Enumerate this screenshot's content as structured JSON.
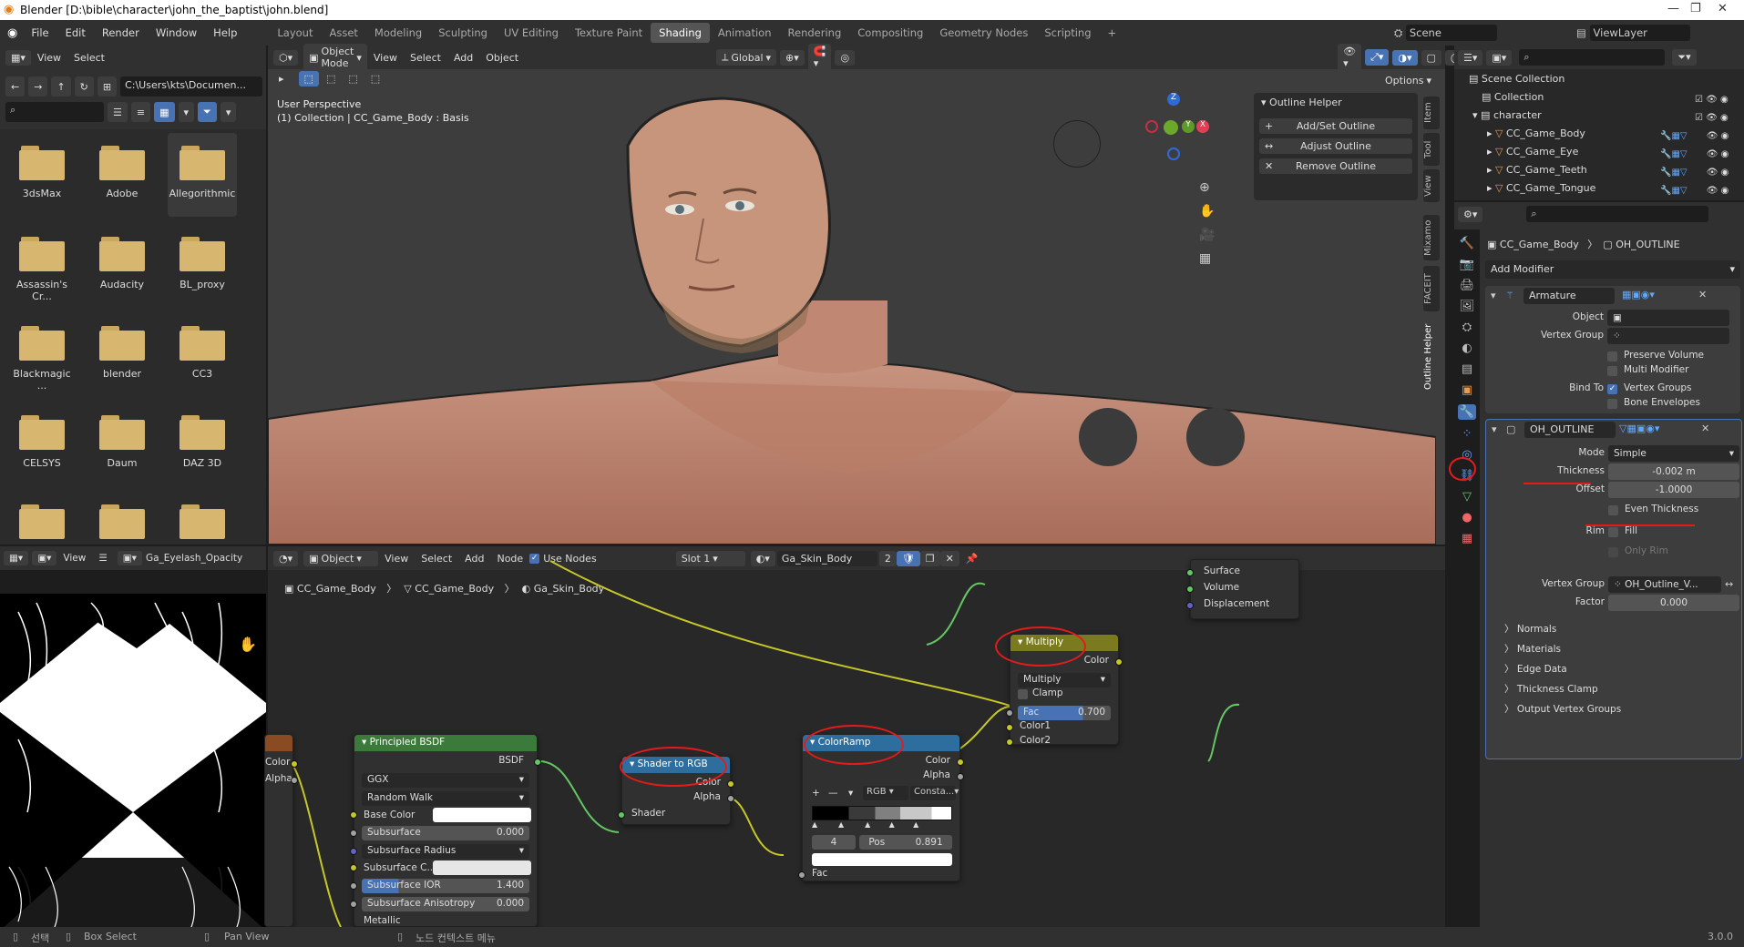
{
  "window": {
    "title": "Blender [D:\\bible\\character\\john_the_baptist\\john.blend]"
  },
  "menus": [
    "File",
    "Edit",
    "Render",
    "Window",
    "Help"
  ],
  "workspaces": [
    {
      "label": "Layout"
    },
    {
      "label": "Asset"
    },
    {
      "label": "Modeling"
    },
    {
      "label": "Sculpting"
    },
    {
      "label": "UV Editing"
    },
    {
      "label": "Texture Paint"
    },
    {
      "label": "Shading",
      "active": true
    },
    {
      "label": "Animation"
    },
    {
      "label": "Rendering"
    },
    {
      "label": "Compositing"
    },
    {
      "label": "Geometry Nodes"
    },
    {
      "label": "Scripting"
    }
  ],
  "scene": "Scene",
  "view_layer": "ViewLayer",
  "file_browser": {
    "view": "View",
    "select": "Select",
    "path": "C:\\Users\\kts\\Documen...",
    "folders": [
      "3dsMax",
      "Adobe",
      "Allegorithmic",
      "Assassin's Cr...",
      "Audacity",
      "BL_proxy",
      "Blackmagic ...",
      "blender",
      "CC3",
      "CELSYS",
      "Daum",
      "DAZ 3D"
    ]
  },
  "viewport": {
    "mode": "Object Mode",
    "view": "View",
    "select": "Select",
    "add": "Add",
    "object": "Object",
    "orientation": "Global",
    "options": "Options",
    "perspective": "User Perspective",
    "collection_info": "(1) Collection | CC_Game_Body : Basis",
    "gizmo": {
      "x": "X",
      "y": "Y",
      "z": "Z"
    }
  },
  "outline_helper": {
    "title": "Outline Helper",
    "buttons": [
      "Add/Set Outline",
      "Adjust Outline",
      "Remove Outline"
    ]
  },
  "side_tabs": [
    "Item",
    "Tool",
    "View",
    "Mixamo",
    "FACEIT",
    "Outline Helper"
  ],
  "outliner": {
    "scene_collection": "Scene Collection",
    "collection": "Collection",
    "character": "character",
    "items": [
      "CC_Game_Body",
      "CC_Game_Eye",
      "CC_Game_Teeth",
      "CC_Game_Tongue"
    ]
  },
  "properties": {
    "breadcrumb_obj": "CC_Game_Body",
    "breadcrumb_mod": "OH_OUTLINE",
    "add_modifier": "Add Modifier",
    "armature": {
      "name": "Armature",
      "object_label": "Object",
      "vgroup_label": "Vertex Group",
      "preserve_volume": "Preserve Volume",
      "multi_modifier": "Multi Modifier",
      "bind_to": "Bind To",
      "vertex_groups": "Vertex Groups",
      "bone_envelopes": "Bone Envelopes"
    },
    "outline": {
      "name": "OH_OUTLINE",
      "mode_label": "Mode",
      "mode": "Simple",
      "thickness_label": "Thickness",
      "thickness": "-0.002 m",
      "offset_label": "Offset",
      "offset": "-1.0000",
      "even_thickness": "Even Thickness",
      "rim_label": "Rim",
      "fill": "Fill",
      "only_rim": "Only Rim",
      "vgroup_label": "Vertex Group",
      "vgroup": "OH_Outline_V...",
      "factor_label": "Factor",
      "factor": "0.000",
      "subpanels": [
        "Normals",
        "Materials",
        "Edge Data",
        "Thickness Clamp",
        "Output Vertex Groups"
      ]
    }
  },
  "image_editor": {
    "view": "View",
    "image": "Ga_Eyelash_Opacity"
  },
  "node_editor": {
    "object": "Object",
    "view": "View",
    "select": "Select",
    "add": "Add",
    "node": "Node",
    "use_nodes": "Use Nodes",
    "slot": "Slot 1",
    "material": "Ga_Skin_Body",
    "users": "2",
    "breadcrumb": [
      "CC_Game_Body",
      "CC_Game_Body",
      "Ga_Skin_Body"
    ],
    "output": {
      "surface": "Surface",
      "volume": "Volume",
      "displacement": "Displacement"
    },
    "multiply": {
      "title": "Multiply",
      "color": "Color",
      "op": "Multiply",
      "clamp": "Clamp",
      "fac_label": "Fac",
      "fac": "0.700",
      "color1": "Color1",
      "color2": "Color2"
    },
    "bsdf": {
      "title": "Principled BSDF",
      "out": "BSDF",
      "dist": "GGX",
      "sss_method": "Random Walk",
      "rows": [
        {
          "l": "Base Color",
          "v": ""
        },
        {
          "l": "Subsurface",
          "v": "0.000"
        },
        {
          "l": "Subsurface Radius",
          "v": ""
        },
        {
          "l": "Subsurface C...",
          "v": ""
        },
        {
          "l": "Subsurface IOR",
          "v": "1.400"
        },
        {
          "l": "Subsurface Anisotropy",
          "v": "0.000"
        }
      ],
      "metallic": "Metallic"
    },
    "shader_to_rgb": {
      "title": "Shader to RGB",
      "color": "Color",
      "alpha": "Alpha",
      "shader": "Shader"
    },
    "colorramp": {
      "title": "ColorRamp",
      "color": "Color",
      "alpha": "Alpha",
      "mode": "RGB",
      "interp": "Consta...",
      "index": "4",
      "pos_label": "Pos",
      "pos": "0.891",
      "fac": "Fac"
    },
    "tex_out": {
      "color": "Color",
      "alpha": "Alpha"
    }
  },
  "statusbar": {
    "select": "선택",
    "box_select": "Box Select",
    "pan_view": "Pan View",
    "context": "노드 컨텍스트 메뉴",
    "version": "3.0.0"
  }
}
